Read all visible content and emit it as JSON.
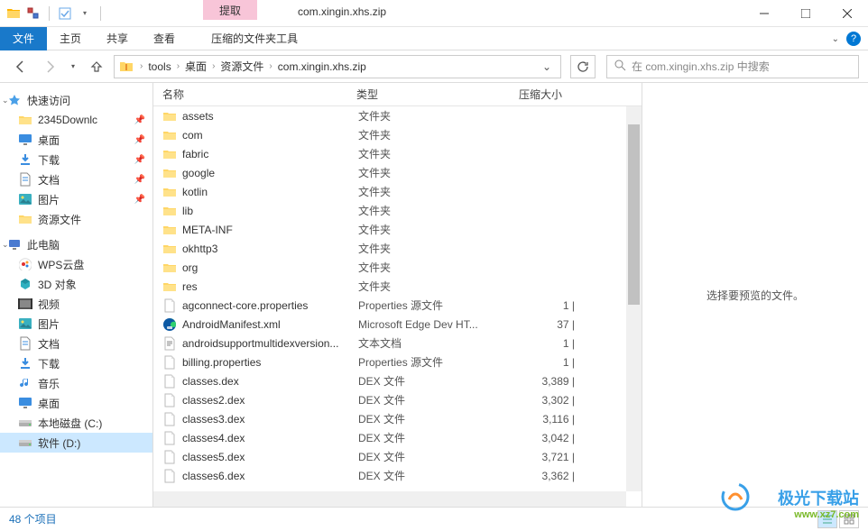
{
  "titlebar": {
    "context_label": "提取",
    "title": "com.xingin.xhs.zip"
  },
  "ribbon": {
    "file": "文件",
    "tabs": [
      "主页",
      "共享",
      "查看"
    ],
    "context_tab": "压缩的文件夹工具"
  },
  "breadcrumb": {
    "items": [
      "tools",
      "桌面",
      "资源文件",
      "com.xingin.xhs.zip"
    ]
  },
  "search": {
    "placeholder": "在 com.xingin.xhs.zip 中搜索"
  },
  "sidebar": {
    "quick_access": {
      "label": "快速访问",
      "items": [
        {
          "label": "2345Downlc",
          "pinned": true,
          "icon": "folder"
        },
        {
          "label": "桌面",
          "pinned": true,
          "icon": "desktop"
        },
        {
          "label": "下载",
          "pinned": true,
          "icon": "download"
        },
        {
          "label": "文档",
          "pinned": true,
          "icon": "document"
        },
        {
          "label": "图片",
          "pinned": true,
          "icon": "picture"
        },
        {
          "label": "资源文件",
          "pinned": false,
          "icon": "folder"
        }
      ]
    },
    "this_pc": {
      "label": "此电脑",
      "items": [
        {
          "label": "WPS云盘",
          "icon": "wps"
        },
        {
          "label": "3D 对象",
          "icon": "3d"
        },
        {
          "label": "视频",
          "icon": "video"
        },
        {
          "label": "图片",
          "icon": "picture"
        },
        {
          "label": "文档",
          "icon": "document"
        },
        {
          "label": "下载",
          "icon": "download"
        },
        {
          "label": "音乐",
          "icon": "music"
        },
        {
          "label": "桌面",
          "icon": "desktop"
        },
        {
          "label": "本地磁盘 (C:)",
          "icon": "drive"
        },
        {
          "label": "软件 (D:)",
          "icon": "drive",
          "selected": true
        }
      ]
    }
  },
  "columns": {
    "name": "名称",
    "type": "类型",
    "size": "压缩大小"
  },
  "files": [
    {
      "name": "assets",
      "type": "文件夹",
      "size": "",
      "icon": "folder"
    },
    {
      "name": "com",
      "type": "文件夹",
      "size": "",
      "icon": "folder"
    },
    {
      "name": "fabric",
      "type": "文件夹",
      "size": "",
      "icon": "folder"
    },
    {
      "name": "google",
      "type": "文件夹",
      "size": "",
      "icon": "folder"
    },
    {
      "name": "kotlin",
      "type": "文件夹",
      "size": "",
      "icon": "folder"
    },
    {
      "name": "lib",
      "type": "文件夹",
      "size": "",
      "icon": "folder"
    },
    {
      "name": "META-INF",
      "type": "文件夹",
      "size": "",
      "icon": "folder"
    },
    {
      "name": "okhttp3",
      "type": "文件夹",
      "size": "",
      "icon": "folder"
    },
    {
      "name": "org",
      "type": "文件夹",
      "size": "",
      "icon": "folder"
    },
    {
      "name": "res",
      "type": "文件夹",
      "size": "",
      "icon": "folder"
    },
    {
      "name": "agconnect-core.properties",
      "type": "Properties 源文件",
      "size": "1 |",
      "icon": "file"
    },
    {
      "name": "AndroidManifest.xml",
      "type": "Microsoft Edge Dev HT...",
      "size": "37 |",
      "icon": "edge"
    },
    {
      "name": "androidsupportmultidexversion...",
      "type": "文本文档",
      "size": "1 |",
      "icon": "text"
    },
    {
      "name": "billing.properties",
      "type": "Properties 源文件",
      "size": "1 |",
      "icon": "file"
    },
    {
      "name": "classes.dex",
      "type": "DEX 文件",
      "size": "3,389 |",
      "icon": "file"
    },
    {
      "name": "classes2.dex",
      "type": "DEX 文件",
      "size": "3,302 |",
      "icon": "file"
    },
    {
      "name": "classes3.dex",
      "type": "DEX 文件",
      "size": "3,116 |",
      "icon": "file"
    },
    {
      "name": "classes4.dex",
      "type": "DEX 文件",
      "size": "3,042 |",
      "icon": "file"
    },
    {
      "name": "classes5.dex",
      "type": "DEX 文件",
      "size": "3,721 |",
      "icon": "file"
    },
    {
      "name": "classes6.dex",
      "type": "DEX 文件",
      "size": "3,362 |",
      "icon": "file"
    }
  ],
  "preview": {
    "message": "选择要预览的文件。"
  },
  "statusbar": {
    "count": "48 个项目"
  },
  "watermark": {
    "text": "极光下载站",
    "url": "www.xz7.com"
  }
}
